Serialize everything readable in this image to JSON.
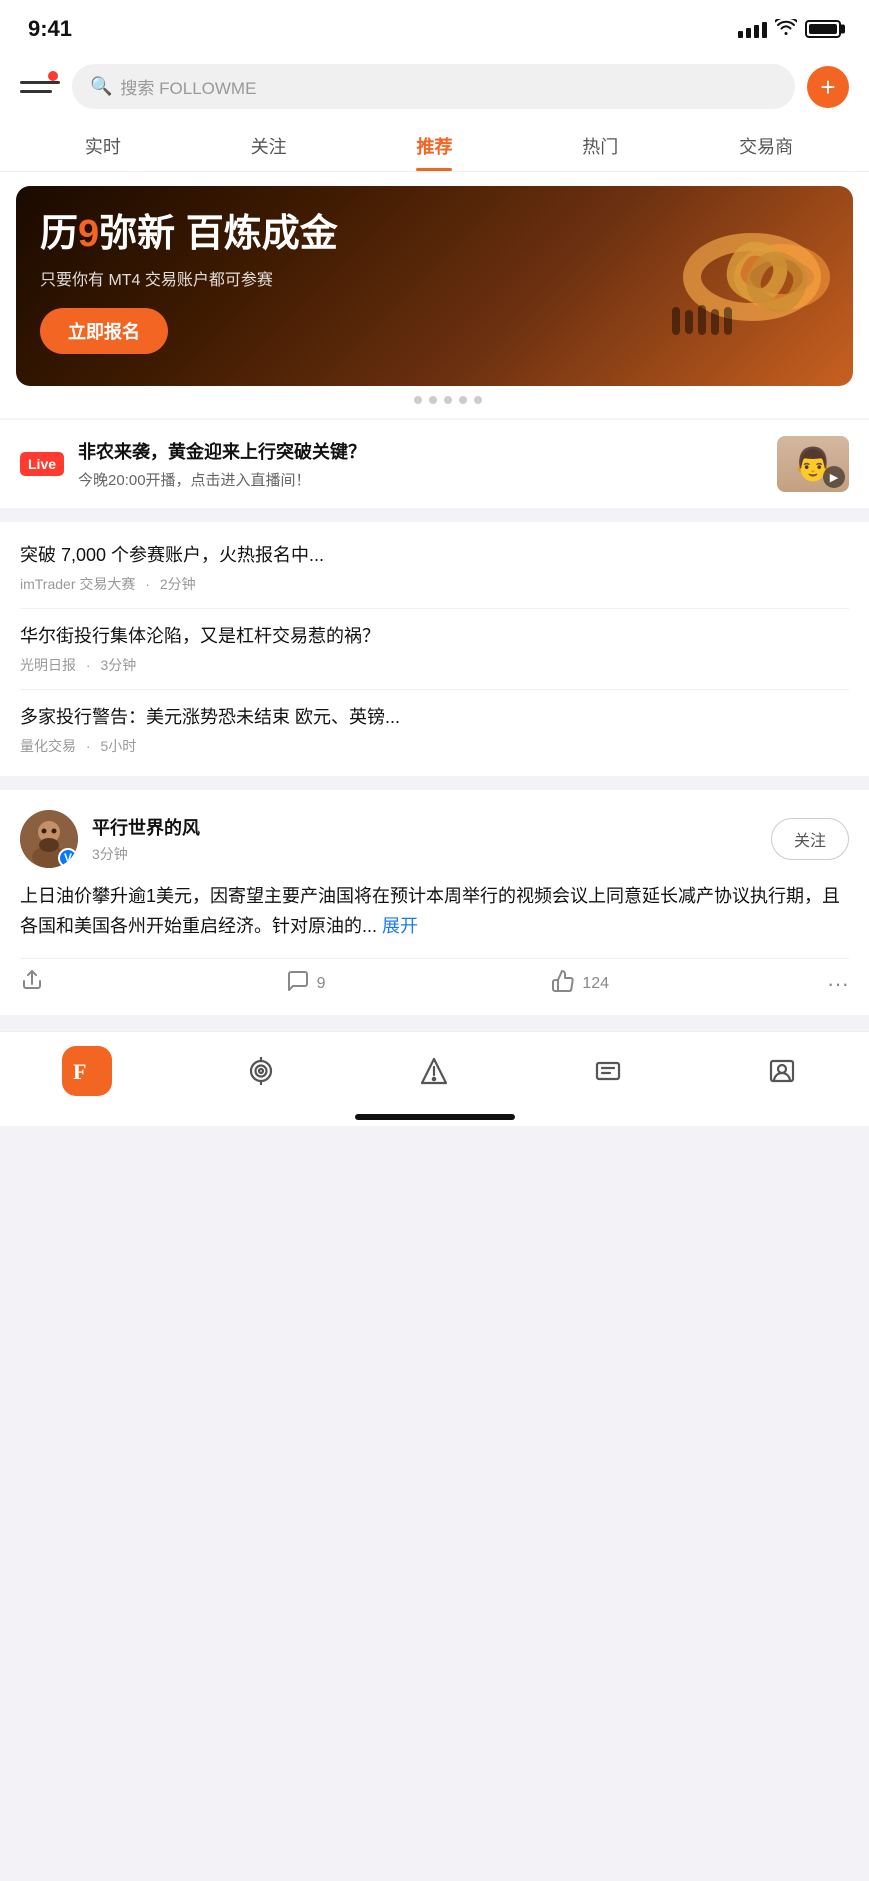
{
  "statusBar": {
    "time": "9:41",
    "signal": "signal",
    "wifi": "wifi",
    "battery": "battery"
  },
  "header": {
    "searchPlaceholder": "搜索 FOLLOWME",
    "addButton": "+"
  },
  "navTabs": {
    "tabs": [
      {
        "id": "realtime",
        "label": "实时",
        "active": false
      },
      {
        "id": "follow",
        "label": "关注",
        "active": false
      },
      {
        "id": "recommend",
        "label": "推荐",
        "active": true
      },
      {
        "id": "hot",
        "label": "热门",
        "active": false
      },
      {
        "id": "broker",
        "label": "交易商",
        "active": false
      }
    ]
  },
  "banner": {
    "titlePart1": "历",
    "titleHighlight": "9",
    "titlePart2": "弥新 百炼成金",
    "subtitle": "只要你有 MT4 交易账户都可参赛",
    "buttonLabel": "立即报名",
    "dots": [
      true,
      false,
      false,
      false,
      false,
      false
    ]
  },
  "liveSection": {
    "badge": "Live",
    "title": "非农来袭，黄金迎来上行突破关键？",
    "subtitle": "今晚20:00开播，点击进入直播间！"
  },
  "newsSection": {
    "items": [
      {
        "title": "突破 7,000 个参赛账户，火热报名中...",
        "source": "imTrader 交易大赛",
        "time": "2分钟"
      },
      {
        "title": "华尔街投行集体沦陷，又是杠杆交易惹的祸？",
        "source": "光明日报",
        "time": "3分钟"
      },
      {
        "title": "多家投行警告：美元涨势恐未结束 欧元、英镑...",
        "source": "量化交易",
        "time": "5小时"
      }
    ]
  },
  "post": {
    "username": "平行世界的风",
    "time": "3分钟",
    "verifiedIcon": "V",
    "followLabel": "关注",
    "content": "上日油价攀升逾1美元，因寄望主要产油国将在预计本周举行的视频会议上同意延长减产协议执行期，且各国和美国各州开始重启经济。针对原油的...",
    "expandLabel": "展开",
    "commentCount": "9",
    "likeCount": "124",
    "actions": {
      "share": "share",
      "comment": "comment",
      "like": "like",
      "more": "more"
    }
  },
  "bottomNav": {
    "items": [
      {
        "id": "home",
        "label": "home",
        "icon": "F",
        "active": true
      },
      {
        "id": "signal",
        "label": "signal",
        "icon": "signal",
        "active": false
      },
      {
        "id": "trade",
        "label": "trade",
        "icon": "trade",
        "active": false
      },
      {
        "id": "messages",
        "label": "messages",
        "icon": "msg",
        "active": false
      },
      {
        "id": "profile",
        "label": "profile",
        "icon": "profile",
        "active": false
      }
    ]
  },
  "colors": {
    "primary": "#f26522",
    "blue": "#007aff",
    "red": "#ff3b30",
    "text": "#111",
    "textSecondary": "#999",
    "border": "#eee"
  }
}
